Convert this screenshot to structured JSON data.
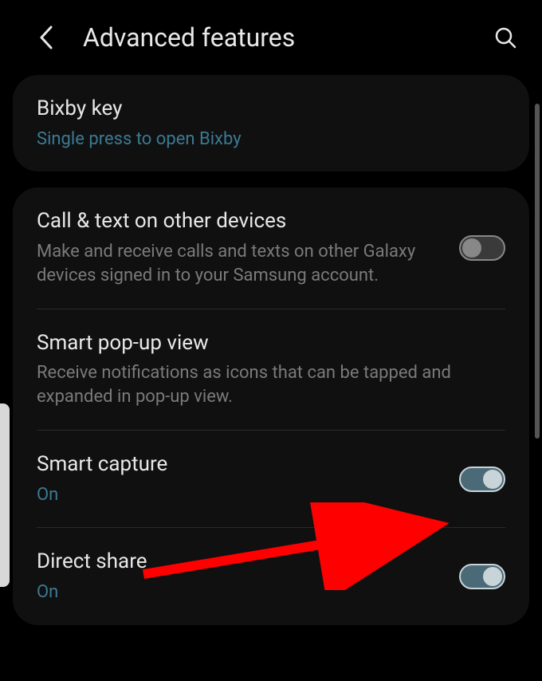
{
  "header": {
    "title": "Advanced features"
  },
  "card1": {
    "bixby": {
      "title": "Bixby key",
      "sub": "Single press to open Bixby"
    }
  },
  "card2": {
    "calltext": {
      "title": "Call & text on other devices",
      "sub": "Make and receive calls and texts on other Galaxy devices signed in to your Samsung account.",
      "on": false
    },
    "popup": {
      "title": "Smart pop-up view",
      "sub": "Receive notifications as icons that can be tapped and expanded in pop-up view."
    },
    "smartcapture": {
      "title": "Smart capture",
      "sub": "On",
      "on": true
    },
    "directshare": {
      "title": "Direct share",
      "sub": "On",
      "on": true
    }
  }
}
